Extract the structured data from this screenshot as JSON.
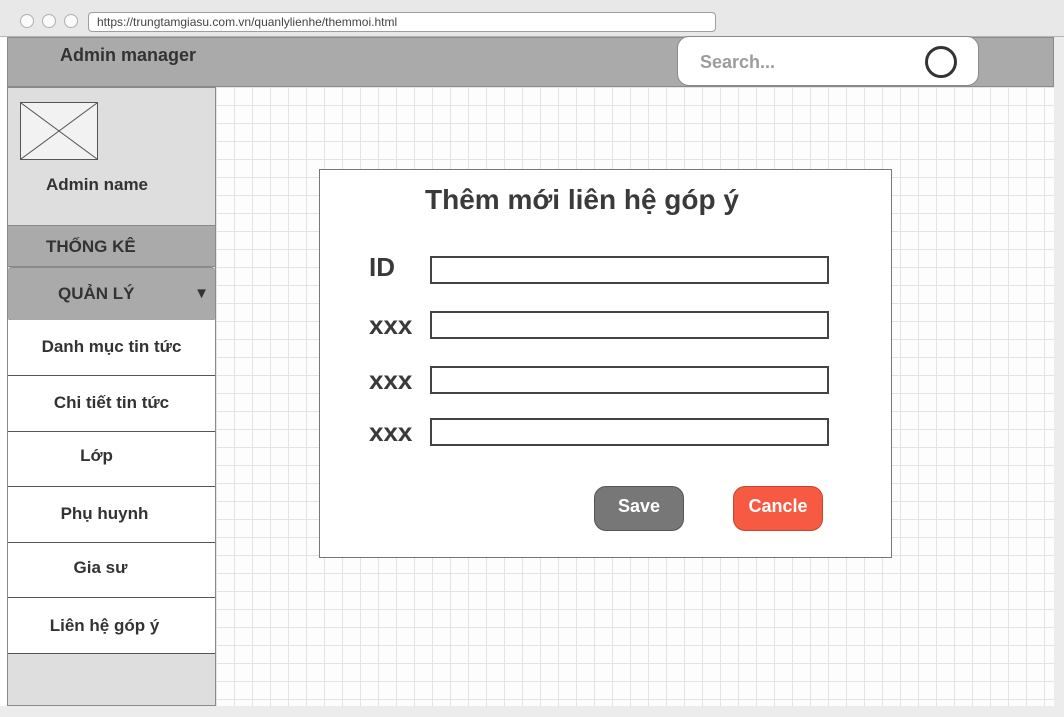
{
  "browser": {
    "url": "https://trungtamgiasu.com.vn/quanlylienhe/themmoi.html"
  },
  "header": {
    "title": "Admin manager",
    "search_placeholder": "Search..."
  },
  "sidebar": {
    "admin_name": "Admin name",
    "stats_label": "THỐNG KÊ",
    "manage_label": "QUẢN LÝ",
    "manage_caret": "▼",
    "items": [
      {
        "label": "Danh mục tin tức"
      },
      {
        "label": "Chi tiết tin tức"
      },
      {
        "label": "Lớp"
      },
      {
        "label": "Phụ huynh"
      },
      {
        "label": "Gia sư"
      },
      {
        "label": "Liên hệ góp ý"
      }
    ]
  },
  "dialog": {
    "title": "Thêm mới liên hệ góp ý",
    "fields": [
      {
        "label": "ID",
        "value": ""
      },
      {
        "label": "xxx",
        "value": ""
      },
      {
        "label": "xxx",
        "value": ""
      },
      {
        "label": "xxx",
        "value": ""
      }
    ],
    "save_label": "Save",
    "cancel_label": "Cancle"
  },
  "colors": {
    "header_bg": "#aaaaaa",
    "save_bg": "#777777",
    "cancel_bg": "#f65a42"
  },
  "icons": [
    "window-close-dot-icon",
    "window-minimize-dot-icon",
    "window-maximize-dot-icon",
    "search-icon",
    "image-placeholder-icon",
    "chevron-down-icon"
  ]
}
